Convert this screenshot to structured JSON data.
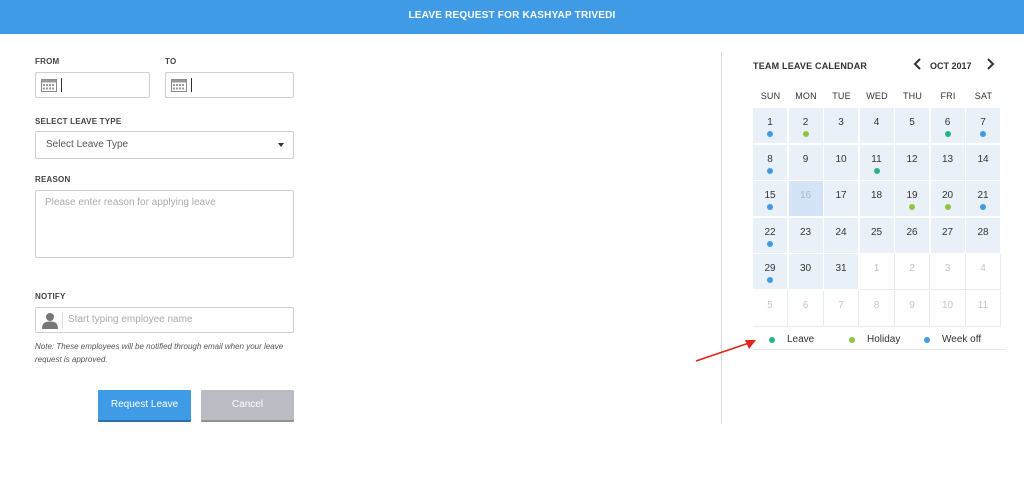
{
  "header": {
    "title": "LEAVE REQUEST FOR KASHYAP TRIVEDI"
  },
  "form": {
    "from_label": "FROM",
    "from_value": "",
    "to_label": "TO",
    "to_value": "",
    "leave_type_label": "SELECT LEAVE TYPE",
    "leave_type_value": "Select Leave Type",
    "reason_label": "REASON",
    "reason_placeholder": "Please enter reason for applying leave",
    "notify_label": "NOTIFY",
    "notify_placeholder": "Start typing employee name",
    "note": "Note: These employees will be notified through email when your leave request is approved.",
    "request_button": "Request Leave",
    "cancel_button": "Cancel"
  },
  "calendar": {
    "title": "TEAM LEAVE CALENDAR",
    "month": "OCT 2017",
    "prev_icon": "chevron-left-icon",
    "next_icon": "chevron-right-icon",
    "weekdays": [
      "SUN",
      "MON",
      "TUE",
      "WED",
      "THU",
      "FRI",
      "SAT"
    ],
    "weeks": [
      [
        {
          "d": "1",
          "dot": "weekoff"
        },
        {
          "d": "2",
          "dot": "holiday"
        },
        {
          "d": "3"
        },
        {
          "d": "4"
        },
        {
          "d": "5"
        },
        {
          "d": "6",
          "dot": "leave"
        },
        {
          "d": "7",
          "dot": "weekoff"
        }
      ],
      [
        {
          "d": "8",
          "dot": "weekoff"
        },
        {
          "d": "9"
        },
        {
          "d": "10"
        },
        {
          "d": "11",
          "dot": "leave"
        },
        {
          "d": "12"
        },
        {
          "d": "13"
        },
        {
          "d": "14"
        }
      ],
      [
        {
          "d": "15",
          "dot": "weekoff"
        },
        {
          "d": "16",
          "today": true
        },
        {
          "d": "17"
        },
        {
          "d": "18"
        },
        {
          "d": "19",
          "dot": "holiday"
        },
        {
          "d": "20",
          "dot": "holiday"
        },
        {
          "d": "21",
          "dot": "weekoff"
        }
      ],
      [
        {
          "d": "22",
          "dot": "weekoff"
        },
        {
          "d": "23"
        },
        {
          "d": "24"
        },
        {
          "d": "25"
        },
        {
          "d": "26"
        },
        {
          "d": "27"
        },
        {
          "d": "28"
        }
      ],
      [
        {
          "d": "29",
          "dot": "weekoff"
        },
        {
          "d": "30"
        },
        {
          "d": "31"
        },
        {
          "d": "1",
          "out": true
        },
        {
          "d": "2",
          "out": true
        },
        {
          "d": "3",
          "out": true
        },
        {
          "d": "4",
          "out": true
        }
      ],
      [
        {
          "d": "5",
          "out": true
        },
        {
          "d": "6",
          "out": true
        },
        {
          "d": "7",
          "out": true
        },
        {
          "d": "8",
          "out": true
        },
        {
          "d": "9",
          "out": true
        },
        {
          "d": "10",
          "out": true
        },
        {
          "d": "11",
          "out": true
        }
      ]
    ],
    "legend": [
      {
        "key": "leave",
        "label": "Leave",
        "color": "#26b38a"
      },
      {
        "key": "holiday",
        "label": "Holiday",
        "color": "#8cc63f"
      },
      {
        "key": "weekoff",
        "label": "Week off",
        "color": "#3f9be6"
      }
    ]
  },
  "colors": {
    "accent": "#3f9be6",
    "arrow": "#e2231a"
  }
}
